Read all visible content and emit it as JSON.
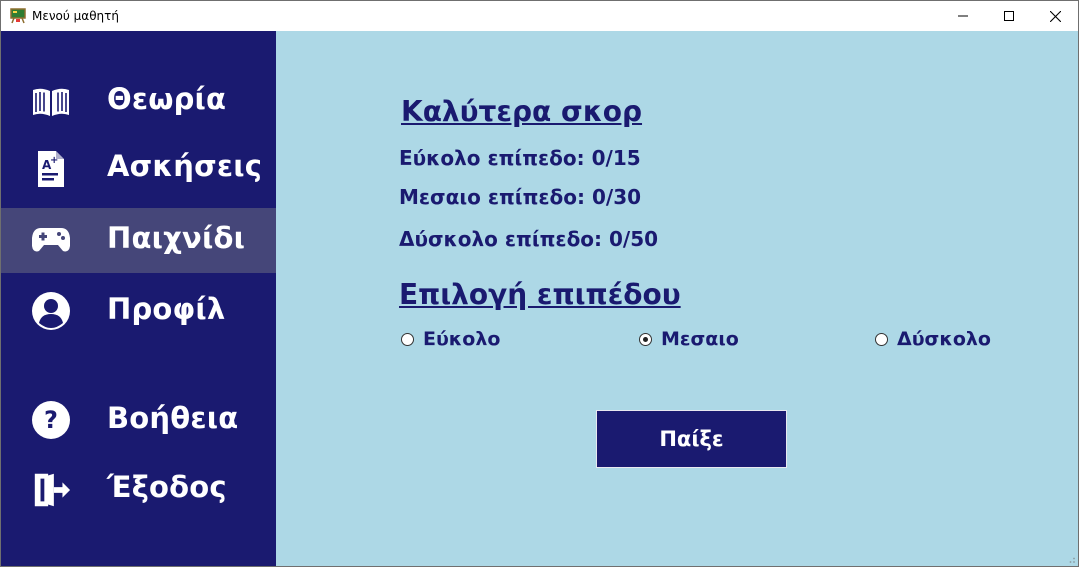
{
  "window": {
    "title": "Μενού μαθητή",
    "controls": {
      "minimize": "minimize-icon",
      "maximize": "maximize-icon",
      "close": "close-icon"
    }
  },
  "sidebar": {
    "items": [
      {
        "label": "Θεωρία",
        "icon": "book-open-icon",
        "active": false
      },
      {
        "label": "Ασκήσεις",
        "icon": "graded-document-icon",
        "active": false
      },
      {
        "label": "Παιχνίδι",
        "icon": "gamepad-icon",
        "active": true
      },
      {
        "label": "Προφίλ",
        "icon": "user-circle-icon",
        "active": false
      },
      {
        "label": "Βοήθεια",
        "icon": "question-circle-icon",
        "active": false
      },
      {
        "label": "Έξοδος",
        "icon": "exit-door-icon",
        "active": false
      }
    ]
  },
  "main": {
    "best_scores": {
      "heading": "Καλύτερα σκορ",
      "easy": "Εύκολο επίπεδο: 0/15",
      "medium": "Μεσαιο επίπεδο: 0/30",
      "hard": "Δύσκολο επίπεδο: 0/50"
    },
    "level_select": {
      "heading": "Επιλογή επιπέδου",
      "options": [
        {
          "label": "Εύκολο",
          "selected": false
        },
        {
          "label": "Μεσαιο",
          "selected": true
        },
        {
          "label": "Δύσκολο",
          "selected": false
        }
      ]
    },
    "play_button": "Παίξε"
  },
  "colors": {
    "sidebar_bg": "#1a1a70",
    "sidebar_active_bg": "#454679",
    "main_bg": "#add8e6",
    "accent_text": "#1a1a70"
  }
}
